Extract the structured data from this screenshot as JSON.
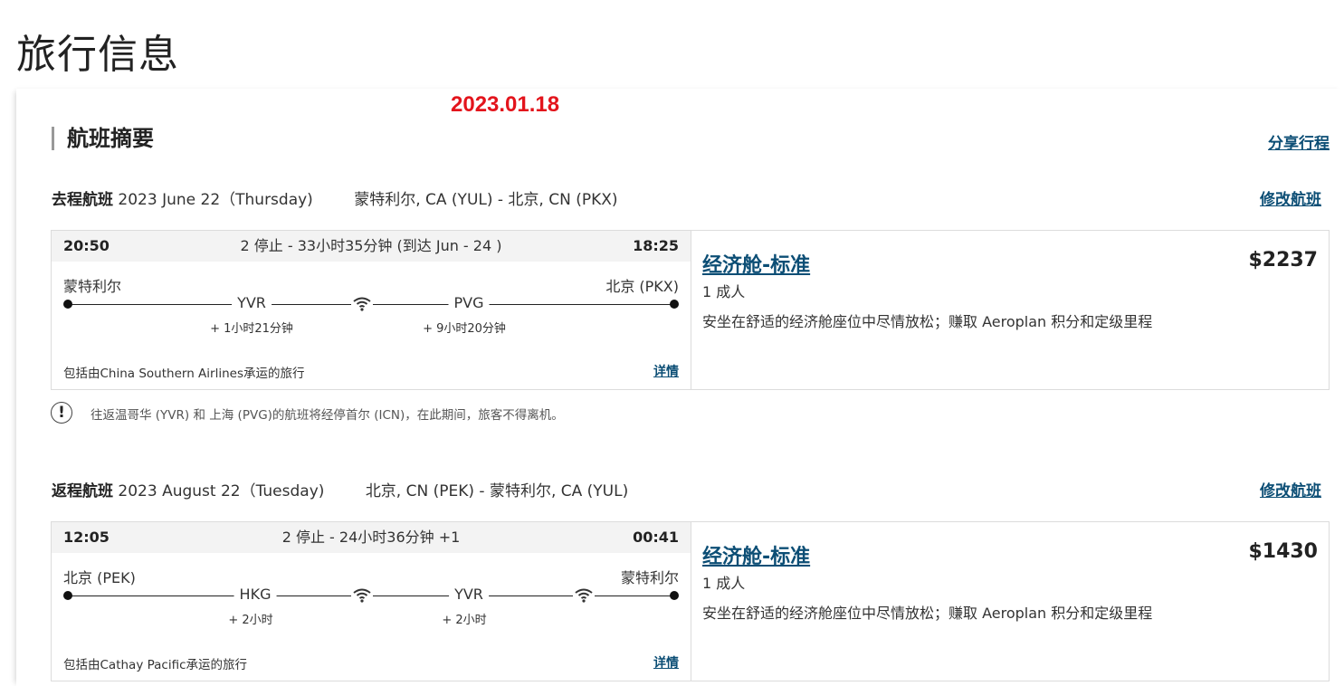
{
  "page_title": "旅行信息",
  "date_stamp": "2023.01.18",
  "summary": {
    "title": "航班摘要",
    "share_label": "分享行程"
  },
  "outbound": {
    "label": "去程航班",
    "date": "2023 June 22（Thursday)",
    "route": "蒙特利尔, CA (YUL) - 北京, CN (PKX)",
    "modify_label": "修改航班",
    "depart_time": "20:50",
    "summary": "2 停止 - 33小时35分钟 (到达 Jun - 24 )",
    "arrive_time": "18:25",
    "origin_city": "蒙特利尔",
    "dest_city": "北京 (PKX)",
    "stops": [
      {
        "code": "YVR",
        "layover": "+ 1小时21分钟"
      },
      {
        "code": "PVG",
        "layover": "+ 9小时20分钟"
      }
    ],
    "operated_by": "包括由China Southern Airlines承运的旅行",
    "details_label": "详情",
    "fare": {
      "name": "经济舱-标准",
      "pax": "1 成人",
      "desc": "安坐在舒适的经济舱座位中尽情放松；赚取 Aeroplan 积分和定级里程",
      "price": "$2237"
    },
    "notice": "往返温哥华 (YVR) 和 上海 (PVG)的航班将经停首尔 (ICN)，在此期间，旅客不得离机。"
  },
  "return": {
    "label": "返程航班",
    "date": "2023 August 22（Tuesday)",
    "route": "北京, CN (PEK) - 蒙特利尔, CA (YUL)",
    "modify_label": "修改航班",
    "depart_time": "12:05",
    "summary": "2 停止 - 24小时36分钟 +1",
    "arrive_time": "00:41",
    "origin_city": "北京 (PEK)",
    "dest_city": "蒙特利尔",
    "stops": [
      {
        "code": "HKG",
        "layover": "+ 2小时"
      },
      {
        "code": "YVR",
        "layover": "+ 2小时"
      }
    ],
    "operated_by": "包括由Cathay Pacific承运的旅行",
    "details_label": "详情",
    "fare": {
      "name": "经济舱-标准",
      "pax": "1 成人",
      "desc": "安坐在舒适的经济舱座位中尽情放松；赚取 Aeroplan 积分和定级里程",
      "price": "$1430"
    }
  },
  "icons": {
    "wifi": "wifi-icon",
    "info": "info-icon"
  }
}
